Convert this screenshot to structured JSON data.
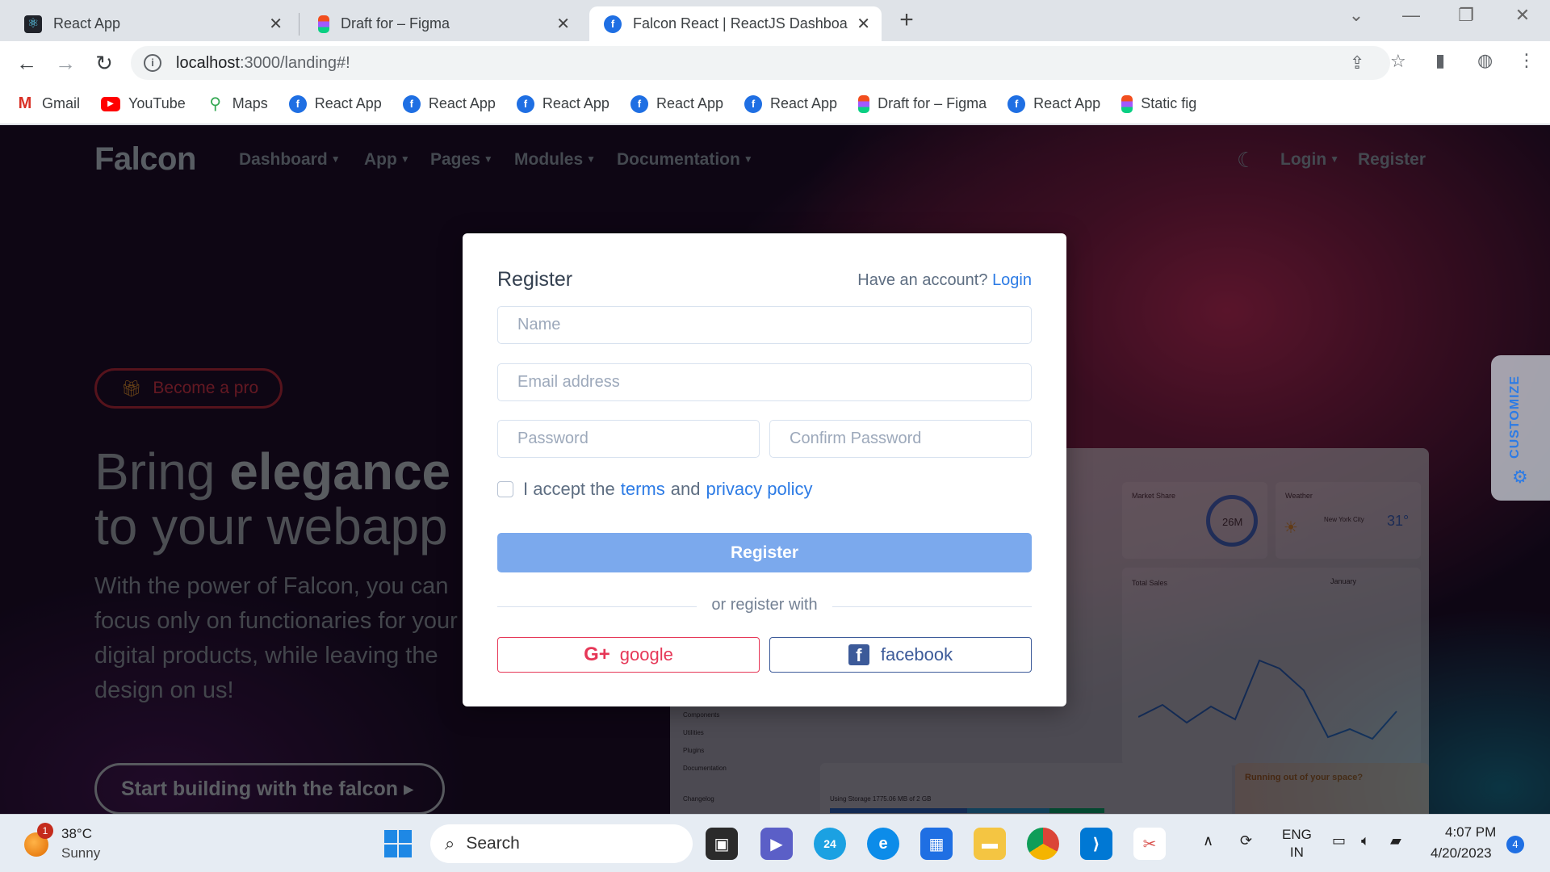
{
  "browser": {
    "tabs": [
      {
        "title": "React App",
        "icon": "react-icon"
      },
      {
        "title": "Draft for – Figma",
        "icon": "figma-icon"
      },
      {
        "title": "Falcon React | ReactJS Dashboard",
        "icon": "falcon-icon"
      }
    ],
    "url_host": "localhost",
    "url_path": ":3000/landing#!",
    "bookmarks": [
      {
        "label": "Gmail",
        "icon": "gmail-icon"
      },
      {
        "label": "YouTube",
        "icon": "youtube-icon"
      },
      {
        "label": "Maps",
        "icon": "maps-icon"
      },
      {
        "label": "React App",
        "icon": "falcon-icon"
      },
      {
        "label": "React App",
        "icon": "falcon-icon"
      },
      {
        "label": "React App",
        "icon": "falcon-icon"
      },
      {
        "label": "React App",
        "icon": "falcon-icon"
      },
      {
        "label": "React App",
        "icon": "falcon-icon"
      },
      {
        "label": "Draft for – Figma",
        "icon": "figma-icon"
      },
      {
        "label": "React App",
        "icon": "falcon-icon"
      },
      {
        "label": "Static fig",
        "icon": "figma-icon"
      }
    ]
  },
  "site": {
    "brand": "Falcon",
    "nav": [
      "Dashboard",
      "App",
      "Pages",
      "Modules",
      "Documentation"
    ],
    "login": "Login",
    "register": "Register",
    "pro_pill": "Become a pro",
    "hero_line1_a": "Bring ",
    "hero_line1_b": "elegance",
    "hero_line2": "to your webapp",
    "hero_text": "With the power of Falcon, you can focus only on functionaries for your digital products, while leaving the design on us!",
    "cta": "Start building with the falcon ▸",
    "customize": "CUSTOMIZE",
    "mock": {
      "market_share": "Market Share",
      "weather": "Weather",
      "ring_value": "26M",
      "city": "New York City",
      "temp": "31°",
      "total_sales": "Total Sales",
      "month": "January",
      "running_out": "Running out of your space?",
      "storage": "Using Storage 1775.06 MB of 2 GB",
      "side_items": [
        "Components",
        "Utilities",
        "Plugins",
        "Documentation",
        "Changelog"
      ]
    }
  },
  "modal": {
    "title": "Register",
    "have_account": "Have an account?",
    "login_link": "Login",
    "name_placeholder": "Name",
    "email_placeholder": "Email address",
    "password_placeholder": "Password",
    "confirm_placeholder": "Confirm Password",
    "accept_prefix": "I accept the",
    "terms": "terms",
    "and": "and",
    "privacy": "privacy policy",
    "register_button": "Register",
    "or_register_with": "or register with",
    "google": "google",
    "facebook": "facebook",
    "colors": {
      "primary": "#2c7be5",
      "register_btn": "#7ba9ed",
      "google": "#e63757",
      "facebook": "#3c5a99"
    }
  },
  "taskbar": {
    "weather_temp": "38°C",
    "weather_desc": "Sunny",
    "weather_badge": "1",
    "search": "Search",
    "lang_1": "ENG",
    "lang_2": "IN",
    "time": "4:07 PM",
    "date": "4/20/2023",
    "notifications": "4",
    "calendar_badge": "24"
  }
}
